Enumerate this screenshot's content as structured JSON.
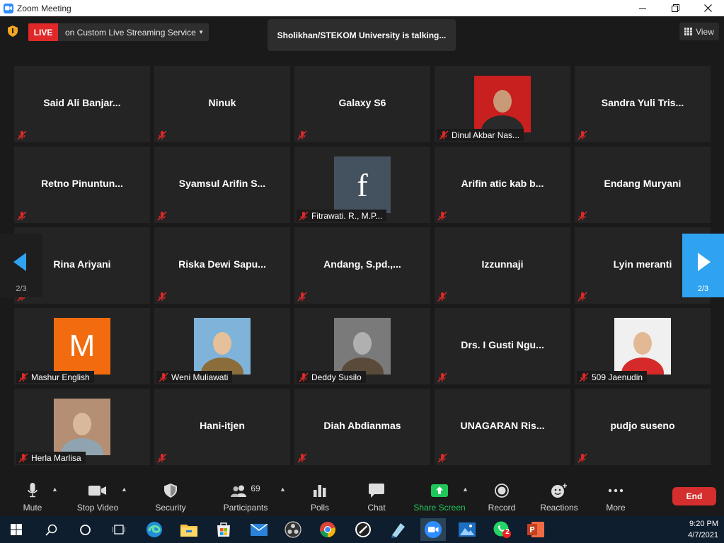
{
  "window": {
    "title": "Zoom Meeting"
  },
  "live": {
    "badge": "LIVE",
    "service": "on Custom Live Streaming Service"
  },
  "talking_indicator": "Sholikhan/STEKOM University is talking...",
  "view_label": "View",
  "pagination": {
    "left": "2/3",
    "right": "2/3"
  },
  "participants": [
    {
      "name": "Said  Ali  Banjar...",
      "video": false
    },
    {
      "name": "Ninuk",
      "video": false
    },
    {
      "name": "Galaxy S6",
      "video": false
    },
    {
      "name": "Dinul Akbar Nas...",
      "video": true,
      "avatar": "photo-man"
    },
    {
      "name": "Sandra  Yuli  Tris...",
      "video": false
    },
    {
      "name": "Retno  Pinuntun...",
      "video": false
    },
    {
      "name": "Syamsul  Arifin  S...",
      "video": false
    },
    {
      "name": "Fitrawati. R., M.P...",
      "video": true,
      "avatar": "facebook-f",
      "avatar_letter": "f"
    },
    {
      "name": "Arifin  atic  kab  b...",
      "video": false
    },
    {
      "name": "Endang Muryani",
      "video": false
    },
    {
      "name": "Rina Ariyani",
      "video": false
    },
    {
      "name": "Riska  Dewi  Sapu...",
      "video": false
    },
    {
      "name": "Andang,  S.pd.,...",
      "video": false
    },
    {
      "name": "Izzunnaji",
      "video": false
    },
    {
      "name": "Lyin meranti",
      "video": false
    },
    {
      "name": "Mashur English",
      "video": true,
      "avatar": "letter-m",
      "avatar_letter": "M"
    },
    {
      "name": "Weni Muliawati",
      "video": true,
      "avatar": "photo-woman"
    },
    {
      "name": "Deddy Susilo",
      "video": true,
      "avatar": "photo-robot"
    },
    {
      "name": "Drs.  I  Gusti  Ngu...",
      "video": false
    },
    {
      "name": "509 Jaenudin",
      "video": true,
      "avatar": "photo-mask"
    },
    {
      "name": "Herla Marlisa",
      "video": true,
      "avatar": "photo-elder"
    },
    {
      "name": "Hani-itjen",
      "video": false
    },
    {
      "name": "Diah Abdianmas",
      "video": false
    },
    {
      "name": "UNAGARAN  Ris...",
      "video": false
    },
    {
      "name": "pudjo suseno",
      "video": false
    }
  ],
  "toolbar": {
    "mute": "Mute",
    "stop_video": "Stop Video",
    "security": "Security",
    "participants": "Participants",
    "participants_count": "69",
    "polls": "Polls",
    "chat": "Chat",
    "share_screen": "Share Screen",
    "record": "Record",
    "reactions": "Reactions",
    "more": "More",
    "end": "End"
  },
  "taskbar": {
    "time": "9:20 PM",
    "date": "4/7/2021",
    "whatsapp_badge": "2"
  },
  "colors": {
    "accent_blue": "#2d8cff",
    "live_red": "#e02828",
    "share_green": "#1fc75a",
    "nav_blue": "#30a3f0",
    "tile_bg": "#242424"
  }
}
